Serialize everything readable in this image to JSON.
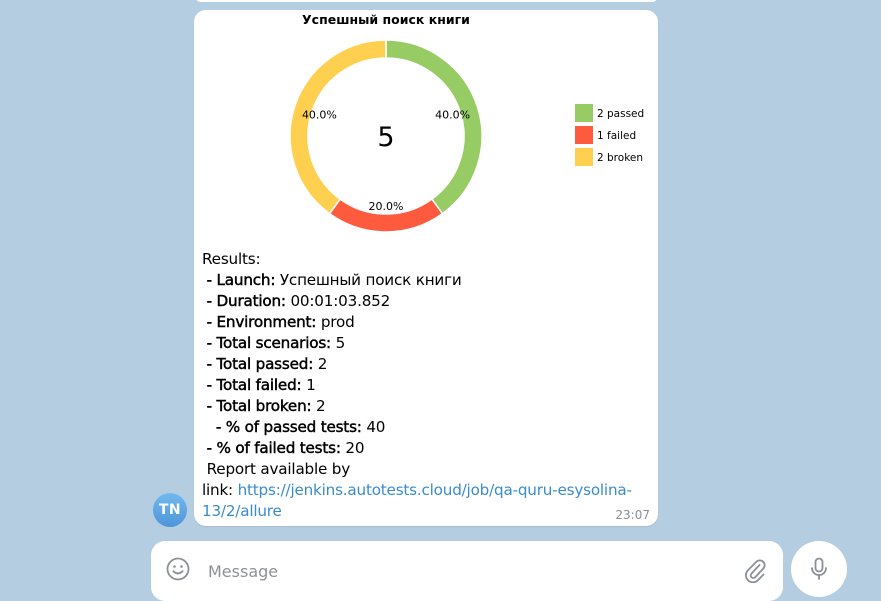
{
  "colors": {
    "background": "#b4cde0",
    "passed": "#97cc64",
    "failed": "#fd5a3e",
    "broken": "#ffd050",
    "link": "#3a8ccc"
  },
  "message": {
    "time": "23:07",
    "avatar_initials": "TN",
    "lines": [
      {
        "plain": "Results:"
      },
      {
        "key": " - Launch:",
        "value": " Успешный поиск книги"
      },
      {
        "key": " - Duration:",
        "value": " 00:01:03.852"
      },
      {
        "key": " - Environment:",
        "value": " prod"
      },
      {
        "key": " - Total scenarios:",
        "value": " 5"
      },
      {
        "key": " - Total passed:",
        "value": " 2"
      },
      {
        "key": " - Total failed:",
        "value": " 1"
      },
      {
        "key": " - Total broken:",
        "value": " 2"
      },
      {
        "key": "   - % of passed tests:",
        "value": " 40"
      },
      {
        "key": " - % of failed tests:",
        "value": " 20"
      },
      {
        "plain": " Report available by"
      }
    ],
    "link_prefix": "link: ",
    "link_line1": "https://jenkins.autotests.cloud/job/qa-quru-esysolina-",
    "link_line2": "13/2/allure"
  },
  "chart_data": {
    "type": "pie",
    "title": "Успешный поиск книги",
    "center_label": "5",
    "categories": [
      "passed",
      "failed",
      "broken"
    ],
    "values": [
      2,
      1,
      2
    ],
    "percent_labels": [
      "40.0%",
      "20.0%",
      "40.0%"
    ],
    "legend": [
      "2 passed",
      "1 failed",
      "2 broken"
    ],
    "colors": [
      "#97cc64",
      "#fd5a3e",
      "#ffd050"
    ],
    "legend_position": "right",
    "donut": true
  },
  "composer": {
    "placeholder": "Message",
    "emoji_icon": "smile-icon",
    "attach_icon": "paperclip-icon",
    "mic_icon": "microphone-icon"
  }
}
